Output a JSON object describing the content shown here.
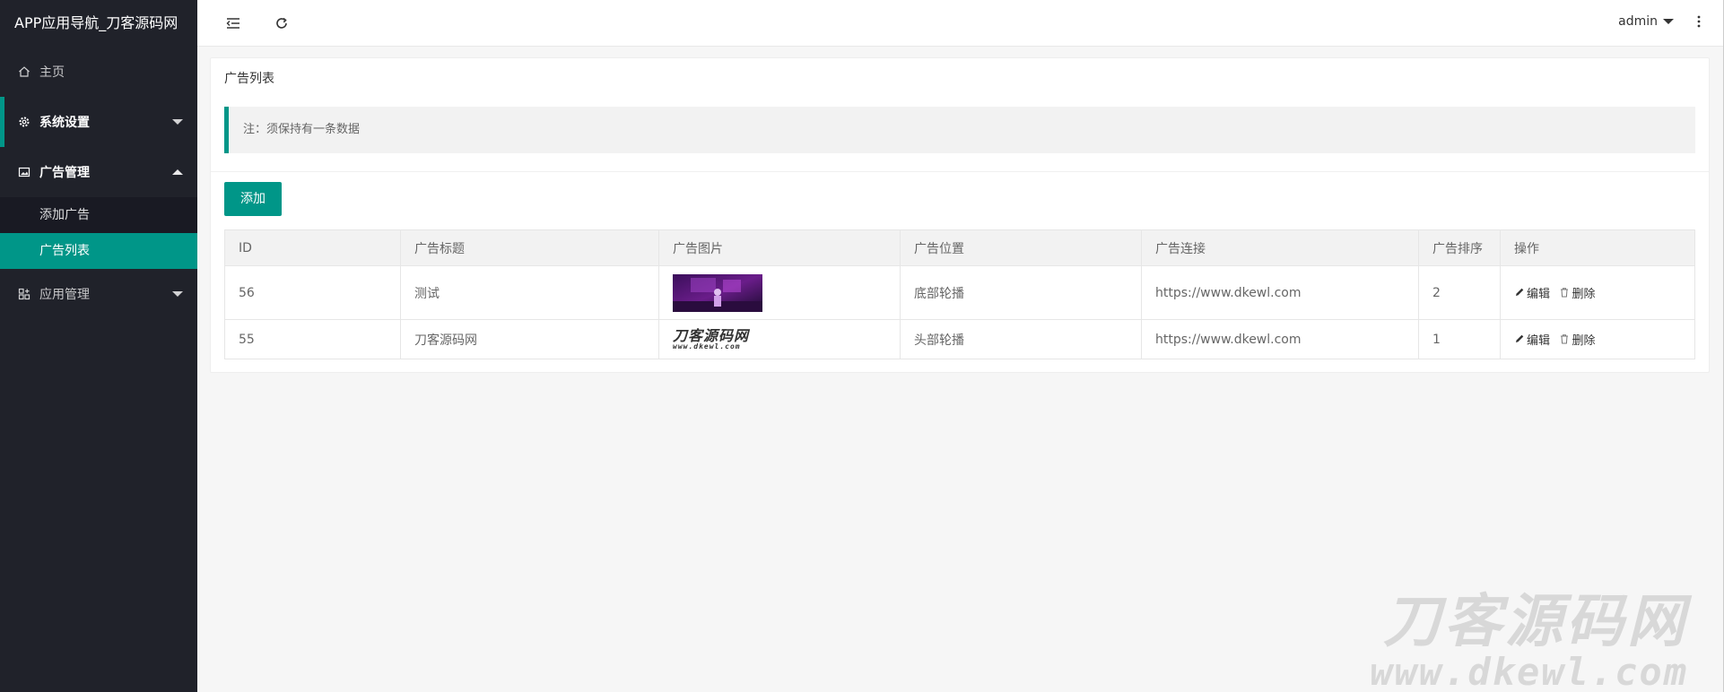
{
  "app": {
    "title": "APP应用导航_刀客源码网"
  },
  "sidebar": {
    "items": [
      {
        "label": "主页",
        "icon": "home-icon"
      },
      {
        "label": "系统设置",
        "icon": "gear-icon"
      },
      {
        "label": "广告管理",
        "icon": "image-icon"
      },
      {
        "label": "应用管理",
        "icon": "apps-icon"
      }
    ],
    "ad_sub": [
      {
        "label": "添加广告"
      },
      {
        "label": "广告列表"
      }
    ]
  },
  "header": {
    "user": "admin"
  },
  "card": {
    "title": "广告列表",
    "note": "注：须保持有一条数据",
    "add_label": "添加"
  },
  "table": {
    "headers": [
      "ID",
      "广告标题",
      "广告图片",
      "广告位置",
      "广告连接",
      "广告排序",
      "操作"
    ],
    "rows": [
      {
        "id": "56",
        "title": "测试",
        "position": "底部轮播",
        "link": "https://www.dkewl.com",
        "sort": "2"
      },
      {
        "id": "55",
        "title": "刀客源码网",
        "position": "头部轮播",
        "link": "https://www.dkewl.com",
        "sort": "1"
      }
    ],
    "edit_label": "编辑",
    "delete_label": "删除",
    "logo_text": "刀客源码网",
    "logo_url": "www.dkewl.com"
  },
  "watermark": {
    "text": "刀客源码网",
    "url": "www.dkewl.com"
  },
  "colors": {
    "accent": "#009688",
    "sidebar": "#20222a",
    "subnav": "#191a23"
  }
}
